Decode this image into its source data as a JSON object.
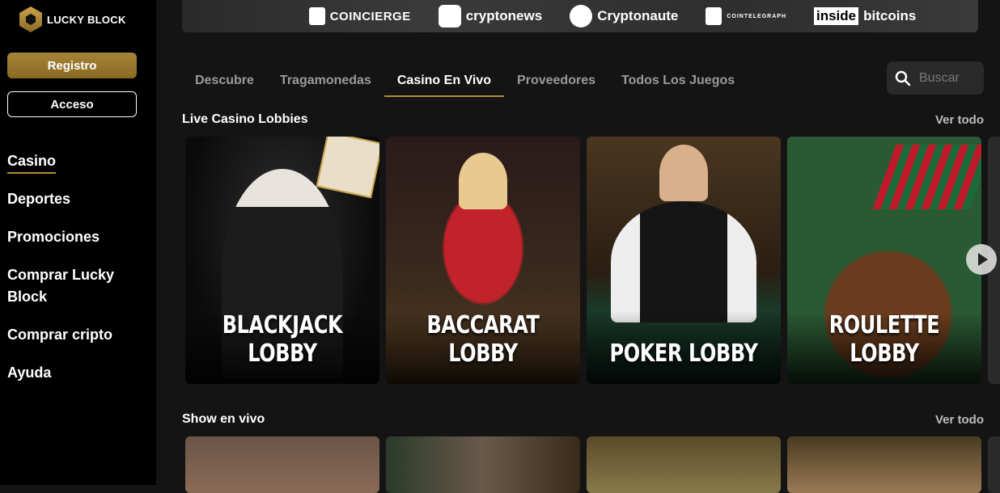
{
  "brand": {
    "name": "LUCKY BLOCK"
  },
  "auth": {
    "register_label": "Registro",
    "login_label": "Acceso"
  },
  "sidebar": {
    "items": [
      {
        "label": "Casino",
        "active": true
      },
      {
        "label": "Deportes"
      },
      {
        "label": "Promociones"
      },
      {
        "label": "Comprar Lucky Block"
      },
      {
        "label": "Comprar cripto"
      },
      {
        "label": "Ayuda"
      }
    ]
  },
  "press": {
    "logos": [
      "COINCIERGE",
      "cryptonews",
      "Cryptonaute",
      "COINTELEGRAPH",
      "inside",
      "bitcoins"
    ]
  },
  "tabs": [
    {
      "label": "Descubre"
    },
    {
      "label": "Tragamonedas"
    },
    {
      "label": "Casino En Vivo",
      "active": true
    },
    {
      "label": "Proveedores"
    },
    {
      "label": "Todos Los Juegos"
    }
  ],
  "search": {
    "placeholder": "Buscar"
  },
  "sections": [
    {
      "title": "Live Casino Lobbies",
      "see_all": "Ver todo",
      "cards": [
        "BLACKJACK LOBBY",
        "BACCARAT LOBBY",
        "POKER LOBBY",
        "ROULETTE LOBBY"
      ]
    },
    {
      "title": "Show en vivo",
      "see_all": "Ver todo"
    }
  ],
  "colors": {
    "accent": "#b58b35",
    "sidebar_bg": "#000000",
    "page_bg": "#141414"
  }
}
